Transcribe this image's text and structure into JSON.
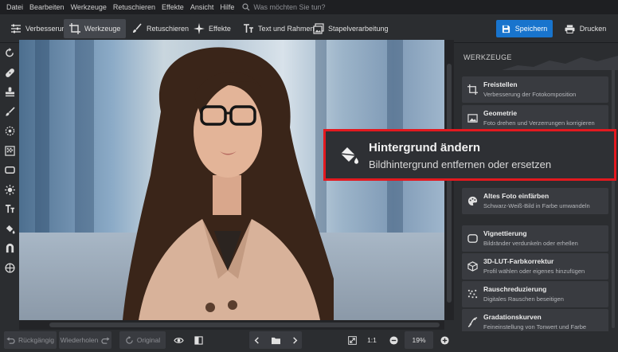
{
  "menubar": {
    "items": [
      "Datei",
      "Bearbeiten",
      "Werkzeuge",
      "Retuschieren",
      "Effekte",
      "Ansicht",
      "Hilfe"
    ],
    "search_placeholder": "Was möchten Sie tun?"
  },
  "toolbar": {
    "tabs": [
      {
        "label": "Verbesserung",
        "icon": "sliders-icon",
        "active": false
      },
      {
        "label": "Werkzeuge",
        "icon": "crop-icon",
        "active": true
      },
      {
        "label": "Retuschieren",
        "icon": "brush-icon",
        "active": false
      },
      {
        "label": "Effekte",
        "icon": "sparkle-icon",
        "active": false
      },
      {
        "label": "Text und Rahmen",
        "icon": "text-icon",
        "active": false
      },
      {
        "label": "Stapelverarbeitung",
        "icon": "batch-icon",
        "active": false
      }
    ],
    "save_label": "Speichern",
    "print_label": "Drucken"
  },
  "left_tools": [
    "rotate-icon",
    "bandage-icon",
    "stamp-icon",
    "brush-icon",
    "radial-icon",
    "gradient-icon",
    "frame-icon",
    "sun-icon",
    "text-icon",
    "bucket-icon",
    "magnet-icon",
    "globe-icon"
  ],
  "panel": {
    "title": "WERKZEUGE",
    "items": [
      {
        "title": "Freistellen",
        "subtitle": "Verbesserung der Fotokomposition",
        "icon": "crop-icon"
      },
      {
        "title": "Geometrie",
        "subtitle": "Foto drehen und Verzerrungen korrigieren",
        "icon": "image-icon"
      },
      {
        "title": "Altes Foto einfärben",
        "subtitle": "Schwarz-Weiß-Bild in Farbe umwandeln",
        "icon": "palette-icon"
      },
      {
        "title": "Vignettierung",
        "subtitle": "Bildränder verdunkeln oder erhellen",
        "icon": "vignette-icon"
      },
      {
        "title": "3D-LUT-Farbkorrektur",
        "subtitle": "Profil wählen oder eigenes hinzufügen",
        "icon": "cube-icon"
      },
      {
        "title": "Rauschreduzierung",
        "subtitle": "Digitales Rauschen beseitigen",
        "icon": "noise-icon"
      },
      {
        "title": "Gradationskurven",
        "subtitle": "Feineinstellung von Tonwert und Farbe",
        "icon": "curve-icon"
      }
    ]
  },
  "callout": {
    "title": "Hintergrund ändern",
    "subtitle": "Bildhintergrund entfernen oder ersetzen",
    "icon": "bucket-icon",
    "border_color": "#e3191f"
  },
  "bottombar": {
    "undo_label": "Rückgängig",
    "redo_label": "Wiederholen",
    "original_label": "Original",
    "ratio_label": "1:1",
    "zoom_value": "19%"
  },
  "colors": {
    "accent": "#1874cd",
    "panel_bg": "#2b2d30",
    "card_bg": "#393b40"
  }
}
